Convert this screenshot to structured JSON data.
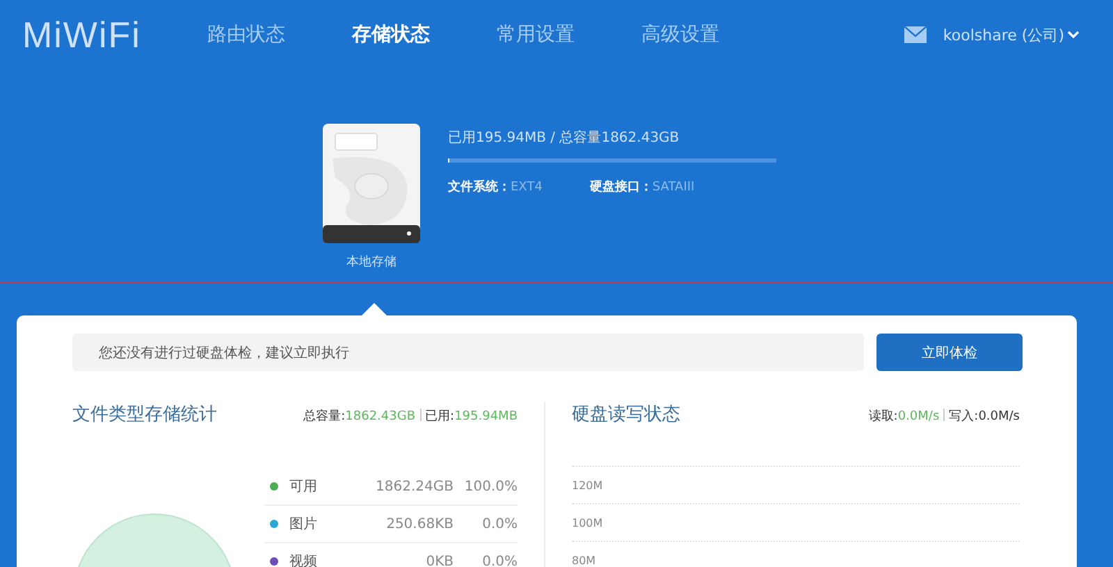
{
  "logo": "MiWiFi",
  "nav": [
    {
      "label": "路由状态",
      "selected": false
    },
    {
      "label": "存储状态",
      "selected": true
    },
    {
      "label": "常用设置",
      "selected": false
    },
    {
      "label": "高级设置",
      "selected": false
    }
  ],
  "user": {
    "name": "koolshare (公司)"
  },
  "disk": {
    "label": "本地存储",
    "usage": "已用195.94MB / 总容量1862.43GB",
    "level": 0.001,
    "fields": [
      {
        "label": "文件系统：",
        "value": "EXT4"
      },
      {
        "label": "硬盘接口：",
        "value": "SATAIII"
      }
    ]
  },
  "notice": {
    "text": "您还没有进行过硬盘体检，建议立即执行",
    "button": "立即体检"
  },
  "file_stats": {
    "title": "文件类型存储统计",
    "total_label": "总容量:",
    "total": "1862.43GB",
    "used_label": "已用:",
    "used": "195.94MB",
    "rows": [
      {
        "name": "可用",
        "size": "1862.24GB",
        "percent": "100.0%",
        "color": "#4caf50"
      },
      {
        "name": "图片",
        "size": "250.68KB",
        "percent": "0.0%",
        "color": "#2aa6d5"
      },
      {
        "name": "视频",
        "size": "0KB",
        "percent": "0.0%",
        "color": "#6a4fb5"
      }
    ]
  },
  "disk_io": {
    "title": "硬盘读写状态",
    "read_label": "读取:",
    "read": "0.0M/s",
    "write_label": "写入:",
    "write": "0.0M/s",
    "axis": [
      "120M",
      "100M",
      "80M"
    ]
  }
}
